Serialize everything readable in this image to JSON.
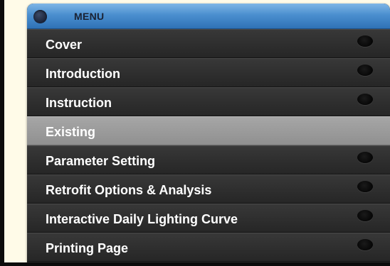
{
  "menu": {
    "title": "MENU",
    "items": [
      {
        "label": "Cover",
        "active": false,
        "has_indicator": true
      },
      {
        "label": "Introduction",
        "active": false,
        "has_indicator": true
      },
      {
        "label": "Instruction",
        "active": false,
        "has_indicator": true
      },
      {
        "label": "Existing",
        "active": true,
        "has_indicator": false
      },
      {
        "label": "Parameter Setting",
        "active": false,
        "has_indicator": true
      },
      {
        "label": "Retrofit Options & Analysis",
        "active": false,
        "has_indicator": true
      },
      {
        "label": "Interactive Daily Lighting Curve",
        "active": false,
        "has_indicator": true
      },
      {
        "label": "Printing Page",
        "active": false,
        "has_indicator": true
      }
    ]
  },
  "colors": {
    "header_blue": "#4b8fcf",
    "item_dark": "#2a2a2a",
    "item_active": "#9a9a9a",
    "page_background": "#fffbe8"
  }
}
